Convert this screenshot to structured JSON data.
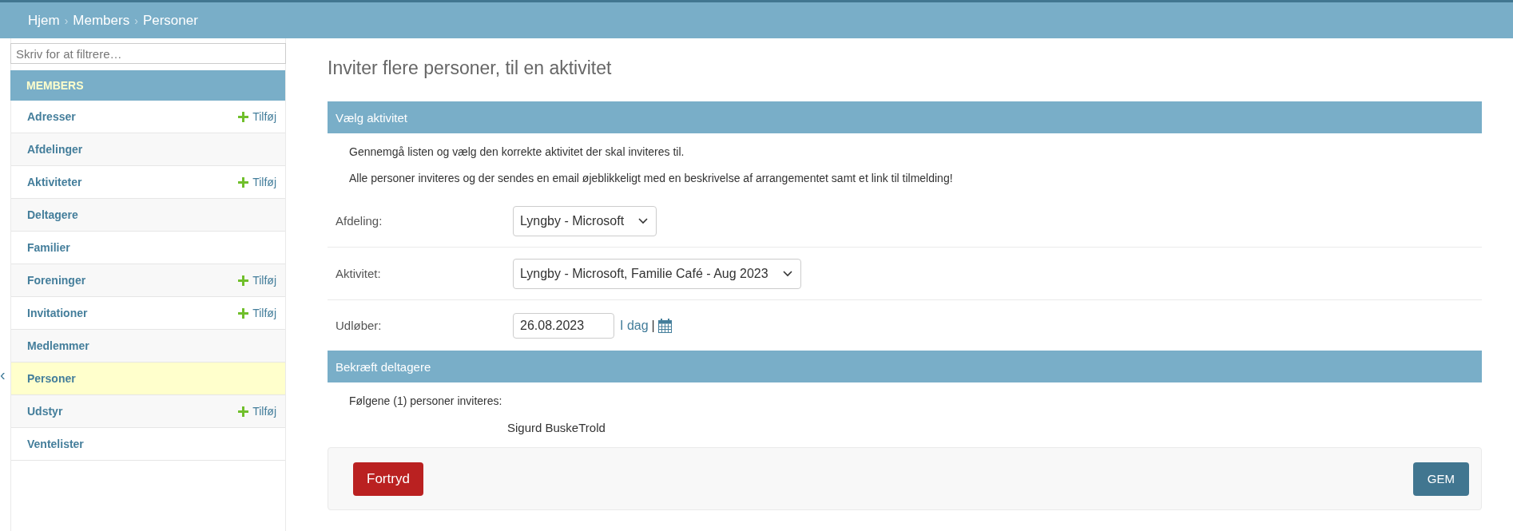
{
  "breadcrumbs": [
    "Hjem",
    "Members",
    "Personer"
  ],
  "breadcrumb_separator": "›",
  "sidebar": {
    "filter_placeholder": "Skriv for at filtrere…",
    "collapse_glyph": "‹",
    "section": "MEMBERS",
    "items": [
      {
        "label": "Adresser",
        "add_link": "Tilføj",
        "selected": false
      },
      {
        "label": "Afdelinger",
        "selected": false
      },
      {
        "label": "Aktiviteter",
        "add_link": "Tilføj",
        "selected": false
      },
      {
        "label": "Deltagere",
        "selected": false
      },
      {
        "label": "Familier",
        "selected": false
      },
      {
        "label": "Foreninger",
        "add_link": "Tilføj",
        "selected": false
      },
      {
        "label": "Invitationer",
        "add_link": "Tilføj",
        "selected": false
      },
      {
        "label": "Medlemmer",
        "selected": false
      },
      {
        "label": "Personer",
        "selected": true
      },
      {
        "label": "Udstyr",
        "add_link": "Tilføj",
        "selected": false
      },
      {
        "label": "Ventelister",
        "selected": false
      }
    ]
  },
  "title": "Inviter flere personer, til en aktivitet",
  "sections": [
    {
      "heading": "Vælg aktivitet",
      "descriptions": [
        "Gennemgå listen og vælg den korrekte aktivitet der skal inviteres til.",
        "Alle personer inviteres og der sendes en email øjeblikkeligt med en beskrivelse af arrangementet samt et link til tilmelding!"
      ],
      "fields": [
        {
          "kind": "select",
          "label": "Afdeling:",
          "value": "Lyngby - Microsoft"
        },
        {
          "kind": "select",
          "label": "Aktivitet:",
          "value": "Lyngby - Microsoft, Familie Café - Aug 2023"
        },
        {
          "kind": "date",
          "label": "Udløber:",
          "value": "26.08.2023",
          "today_link": "I dag",
          "separator": "|"
        }
      ]
    },
    {
      "heading": "Bekræft deltagere",
      "descriptions": [
        "Følgene (1) personer inviteres:"
      ],
      "people": [
        "Sigurd BuskeTrold"
      ]
    }
  ],
  "buttons": {
    "cancel": "Fortryd",
    "save": "GEM"
  }
}
